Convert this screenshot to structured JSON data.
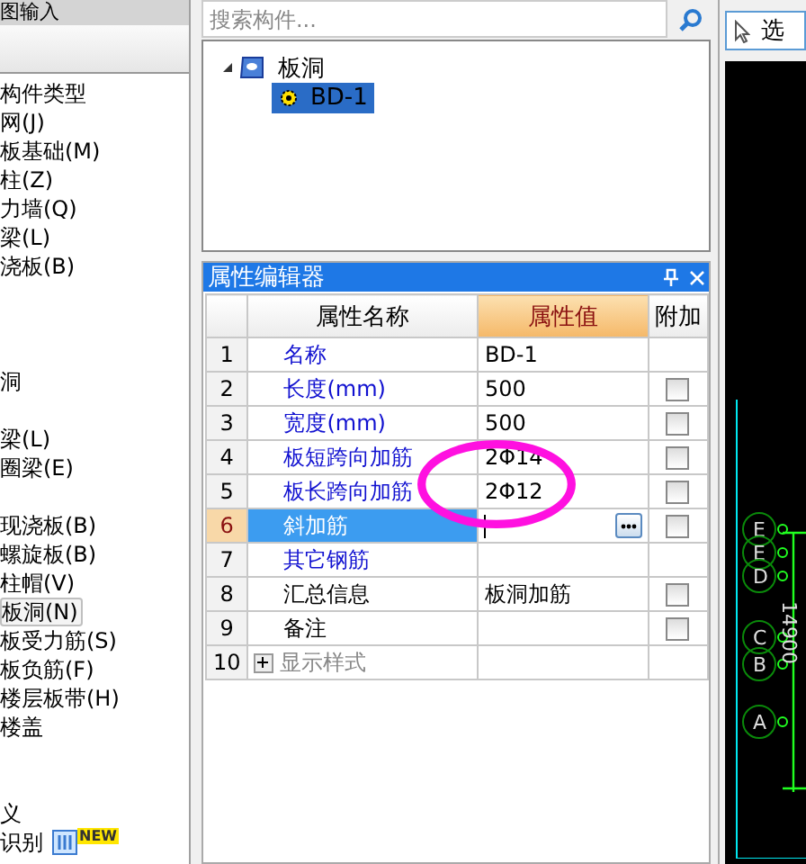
{
  "left_panel": {
    "tab": "图输入",
    "groups": [
      {
        "items": [
          {
            "label": "构件类型",
            "selected": false
          },
          {
            "label": "网(J)",
            "selected": false
          },
          {
            "label": "板基础(M)",
            "selected": false
          },
          {
            "label": "柱(Z)",
            "selected": false
          },
          {
            "label": "力墙(Q)",
            "selected": false
          },
          {
            "label": "梁(L)",
            "selected": false
          },
          {
            "label": "浇板(B)",
            "selected": false
          }
        ]
      },
      {
        "items": [
          {
            "label": "洞",
            "selected": false
          }
        ]
      },
      {
        "items": [
          {
            "label": "梁(L)",
            "selected": false
          },
          {
            "label": "圈梁(E)",
            "selected": false
          }
        ]
      },
      {
        "items": [
          {
            "label": "现浇板(B)",
            "selected": false
          },
          {
            "label": "螺旋板(B)",
            "selected": false
          },
          {
            "label": "柱帽(V)",
            "selected": false
          },
          {
            "label": "板洞(N)",
            "selected": true
          },
          {
            "label": "板受力筋(S)",
            "selected": false
          },
          {
            "label": "板负筋(F)",
            "selected": false
          },
          {
            "label": "楼层板带(H)",
            "selected": false
          }
        ]
      },
      {
        "items": [
          {
            "label": "楼盖",
            "selected": false
          }
        ]
      },
      {
        "items": [
          {
            "label": "义",
            "selected": false
          },
          {
            "label": "识别",
            "selected": false,
            "badge": "NEW"
          }
        ]
      }
    ]
  },
  "search": {
    "placeholder": "搜索构件..."
  },
  "tree": [
    {
      "label": "板洞",
      "expanded": true,
      "selected": false,
      "children": [
        {
          "label": "BD-1",
          "selected": true
        }
      ]
    }
  ],
  "property_editor": {
    "title": "属性编辑器",
    "columns": [
      "属性名称",
      "属性值",
      "附加"
    ],
    "rows": [
      {
        "num": "1",
        "name": "名称",
        "value": "BD-1",
        "kind": "public",
        "selected": false
      },
      {
        "num": "2",
        "name": "长度(mm)",
        "value": "500",
        "kind": "public",
        "selected": false,
        "checked": false
      },
      {
        "num": "3",
        "name": "宽度(mm)",
        "value": "500",
        "kind": "public",
        "selected": false,
        "checked": false
      },
      {
        "num": "4",
        "name": "板短跨向加筋",
        "value": "2Φ14",
        "kind": "public",
        "selected": false,
        "checked": false
      },
      {
        "num": "5",
        "name": "板长跨向加筋",
        "value": "2Φ12",
        "kind": "public",
        "selected": false,
        "checked": false
      },
      {
        "num": "6",
        "name": "斜加筋",
        "kind": "public",
        "selected": true,
        "editing": true,
        "checked": false
      },
      {
        "num": "7",
        "name": "其它钢筋",
        "kind": "public",
        "selected": false
      },
      {
        "num": "8",
        "name": "汇总信息",
        "value": "板洞加筋",
        "kind": "private",
        "selected": false,
        "checked": false
      },
      {
        "num": "9",
        "name": "备注",
        "kind": "private",
        "selected": false,
        "checked": false
      },
      {
        "num": "10",
        "name": "显示样式",
        "kind": "group",
        "selected": false,
        "expanded": false
      }
    ]
  },
  "toolbar": {
    "select_button": "选"
  },
  "canvas": {
    "axis_labels": [
      "E",
      "E",
      "D",
      "C",
      "B",
      "A"
    ],
    "dimension": "14900"
  }
}
